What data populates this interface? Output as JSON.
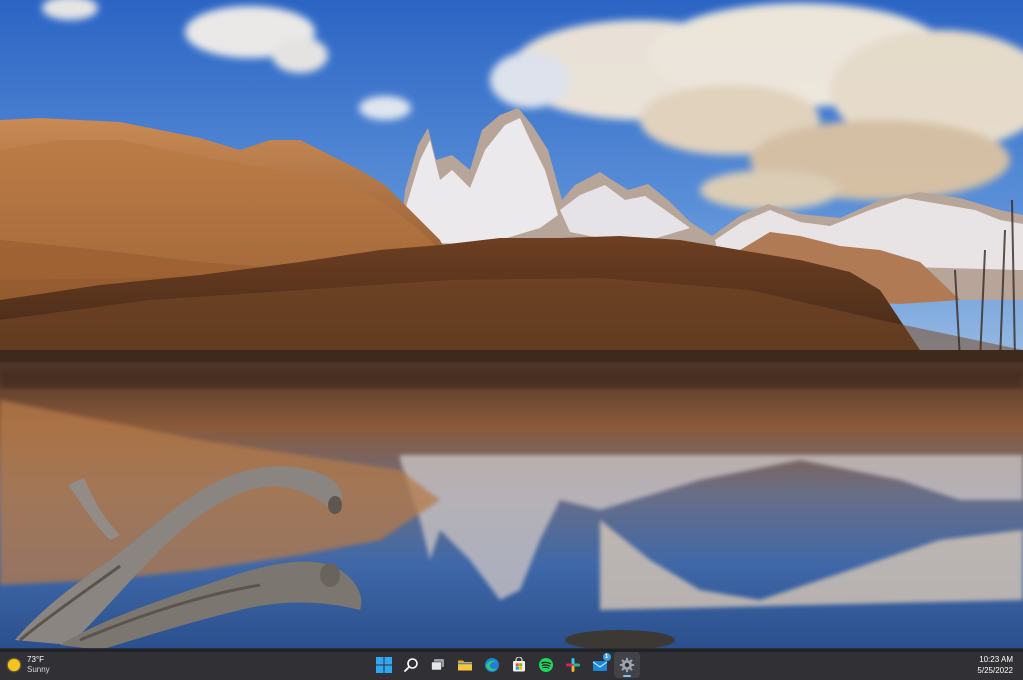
{
  "desktop": {
    "wallpaper": "mountain-lake-landscape"
  },
  "weather": {
    "temperature": "73°F",
    "condition": "Sunny",
    "icon": "sun-icon",
    "icon_color": "#f6c21c"
  },
  "taskbar": {
    "background": "#202024",
    "items": [
      {
        "name": "start-button",
        "icon": "windows-logo-icon"
      },
      {
        "name": "search-button",
        "icon": "search-icon"
      },
      {
        "name": "task-view-button",
        "icon": "task-view-icon"
      },
      {
        "name": "file-explorer-button",
        "icon": "folder-icon"
      },
      {
        "name": "edge-button",
        "icon": "edge-icon"
      },
      {
        "name": "store-button",
        "icon": "store-icon"
      },
      {
        "name": "spotify-button",
        "icon": "spotify-icon"
      },
      {
        "name": "slack-button",
        "icon": "slack-icon"
      },
      {
        "name": "mail-button",
        "icon": "mail-icon",
        "badge": "1"
      },
      {
        "name": "settings-button",
        "icon": "gear-icon",
        "active": true
      }
    ],
    "active_indicator_color": "#7cc0f0"
  },
  "clock": {
    "time": "10:23 AM",
    "date": "5/25/2022"
  }
}
